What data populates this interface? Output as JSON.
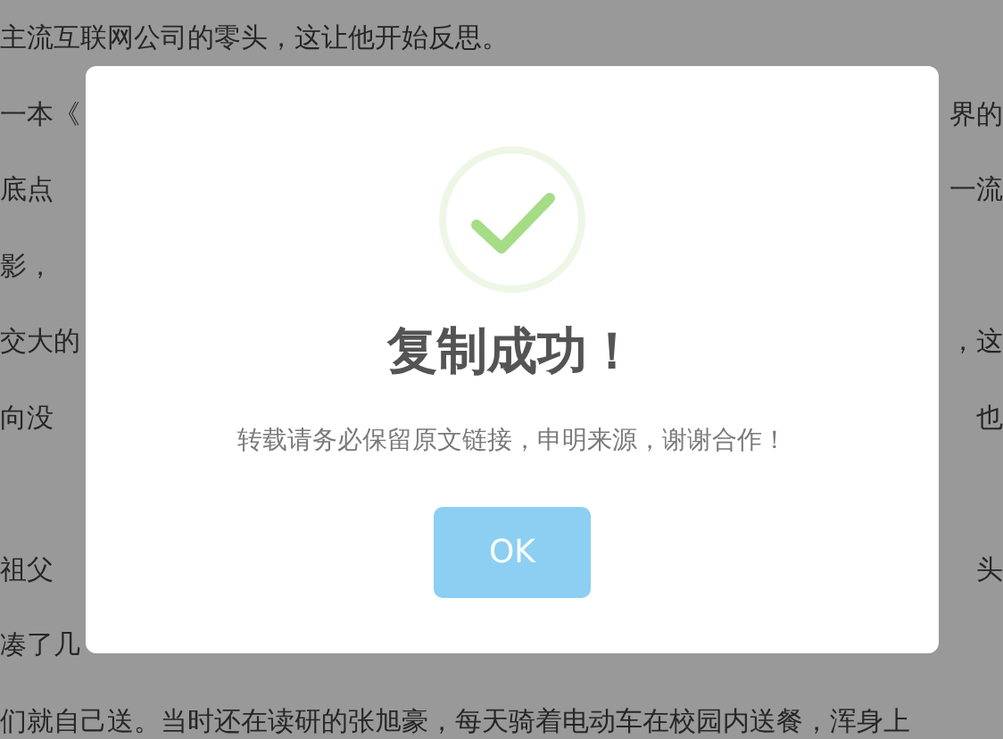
{
  "article_lines": [
    {
      "left": "主流互联网公司的零头，这让他开始反思。"
    },
    {
      "left": "一本《",
      "right": "界的"
    },
    {
      "left": "底点",
      "right": "一流"
    },
    {
      "left": "影，"
    },
    {
      "left": "交大的",
      "right": "，这"
    },
    {
      "left": "向没",
      "right": "也"
    },
    {
      "left": "祖父",
      "right": "头"
    },
    {
      "left": "凑了几"
    },
    {
      "left": "们就自己送。当时还在读研的张旭豪，每天骑着电动车在校园内送餐，浑身上"
    }
  ],
  "dialog": {
    "title": "复制成功！",
    "message": "转载请务必保留原文链接，申明来源，谢谢合作！",
    "button": "OK"
  }
}
